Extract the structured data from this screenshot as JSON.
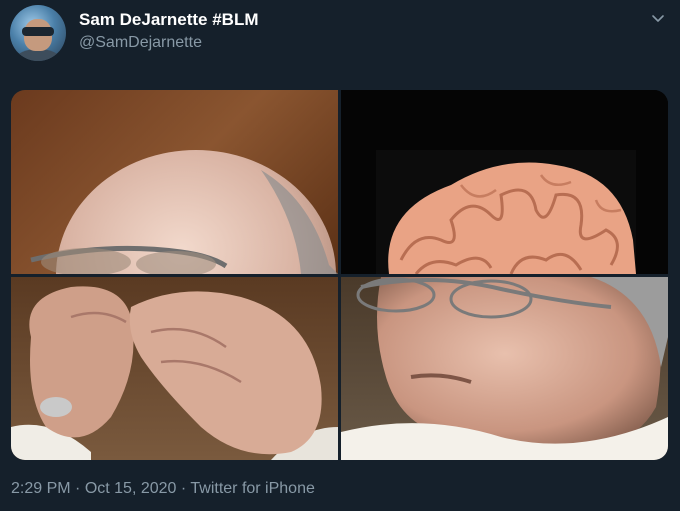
{
  "author": {
    "display_name": "Sam DeJarnette #BLM",
    "handle": "@SamDejarnette",
    "avatar_icon": "profile-photo-avatar"
  },
  "menu": {
    "icon": "chevron-down-icon"
  },
  "media": {
    "panels": [
      {
        "content": "top of bald head with glasses"
      },
      {
        "content": "brain on black background"
      },
      {
        "content": "hands adjusting glasses"
      },
      {
        "content": "man with eyes closed in glasses"
      }
    ]
  },
  "meta": {
    "time": "2:29 PM",
    "separator1": " · ",
    "date": "Oct 15, 2020",
    "separator2": " · ",
    "source": "Twitter for iPhone"
  },
  "colors": {
    "background": "#15202b",
    "secondary_text": "#8899a6",
    "primary_text": "#ffffff"
  }
}
